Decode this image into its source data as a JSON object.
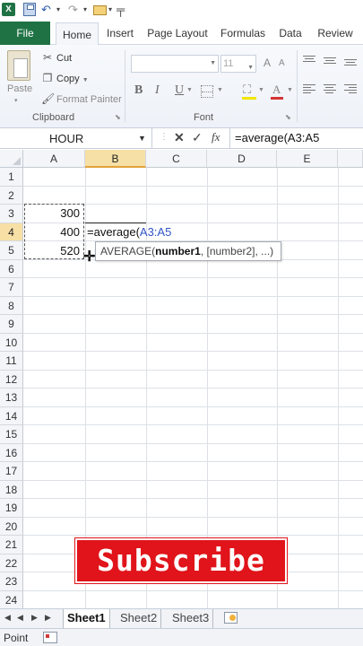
{
  "app": {
    "logo_letter": "X"
  },
  "quick_access": {
    "save_icon": "save-icon",
    "undo_icon": "undo-icon",
    "redo_icon": "redo-icon",
    "open_icon": "open-folder-icon",
    "dropdown_glyph": "▾",
    "customize_glyph": "╤"
  },
  "ribbon_tabs": [
    "File",
    "Home",
    "Insert",
    "Page Layout",
    "Formulas",
    "Data",
    "Review"
  ],
  "clipboard": {
    "paste_label": "Paste",
    "cut_label": "Cut",
    "copy_label": "Copy",
    "format_painter_label": "Format Painter",
    "group_label": "Clipboard"
  },
  "font_group": {
    "font_name": "",
    "font_size": "11",
    "bold": "B",
    "italic": "I",
    "underline": "U",
    "grow": "A",
    "shrink": "A",
    "font_color_glyph": "A",
    "group_label": "Font",
    "fill_color": "#f2e600",
    "font_color": "#d53434"
  },
  "formula_bar": {
    "name_box": "HOUR",
    "cancel": "✕",
    "enter": "✓",
    "fx": "fx",
    "formula": "=average(A3:A5"
  },
  "grid": {
    "columns": [
      "A",
      "B",
      "C",
      "D",
      "E"
    ],
    "selected_column": "B",
    "rows": [
      "1",
      "2",
      "3",
      "4",
      "5",
      "6",
      "7",
      "8",
      "9",
      "10",
      "11",
      "12",
      "13",
      "14",
      "15",
      "16",
      "17",
      "18",
      "19",
      "20",
      "21",
      "22",
      "23",
      "24"
    ],
    "selected_row": "4",
    "cells": {
      "A3": "300",
      "A4": "400",
      "A5": "520"
    },
    "active_cell": {
      "prefix": "=average(",
      "ref": "A3:A5"
    },
    "tooltip": {
      "func": "AVERAGE(",
      "arg1": "number1",
      "rest": ", [number2], ...)"
    }
  },
  "overlay": {
    "subscribe": "Subscribe"
  },
  "sheets": [
    "Sheet1",
    "Sheet2",
    "Sheet3"
  ],
  "active_sheet": "Sheet1",
  "status": {
    "mode": "Point"
  },
  "colors": {
    "accent": "#1f7244",
    "selection_header": "#f7e0a6",
    "subscribe_bg": "#e0141a"
  }
}
